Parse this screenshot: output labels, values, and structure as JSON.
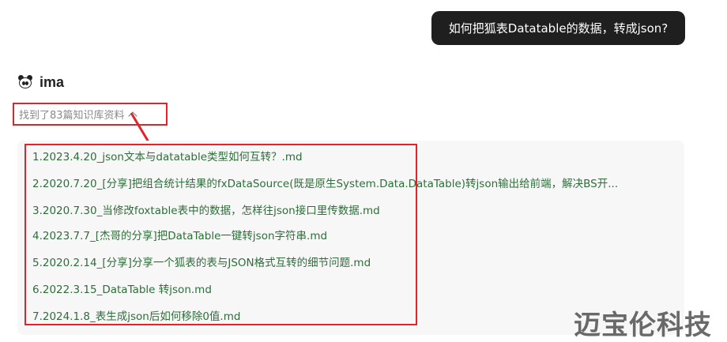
{
  "user_message": "如何把狐表Datatable的数据，转成json?",
  "assistant": {
    "name": "ima",
    "avatar_icon": "panda-icon"
  },
  "found_label": "找到了83篇知识库资料",
  "results": [
    "1.2023.4.20_json文本与datatable类型如何互转？.md",
    "2.2020.7.20_[分享]把组合统计结果的fxDataSource(既是原生System.Data.DataTable)转json输出给前端，解决BS开...",
    "3.2020.7.30_当修改foxtable表中的数据，怎样往json接口里传数据.md",
    "4.2023.7.7_[杰哥的分享]把DataTable一键转json字符串.md",
    "5.2020.2.14_[分享]分享一个狐表的表与JSON格式互转的细节问题.md",
    "6.2022.3.15_DataTable 转json.md",
    "7.2024.1.8_表生成json后如何移除0值.md"
  ],
  "watermark": "迈宝伦科技",
  "colors": {
    "annotation_red": "#e0242a",
    "link_green": "#2e6e3a",
    "bubble_dark": "#1f1f1f"
  }
}
